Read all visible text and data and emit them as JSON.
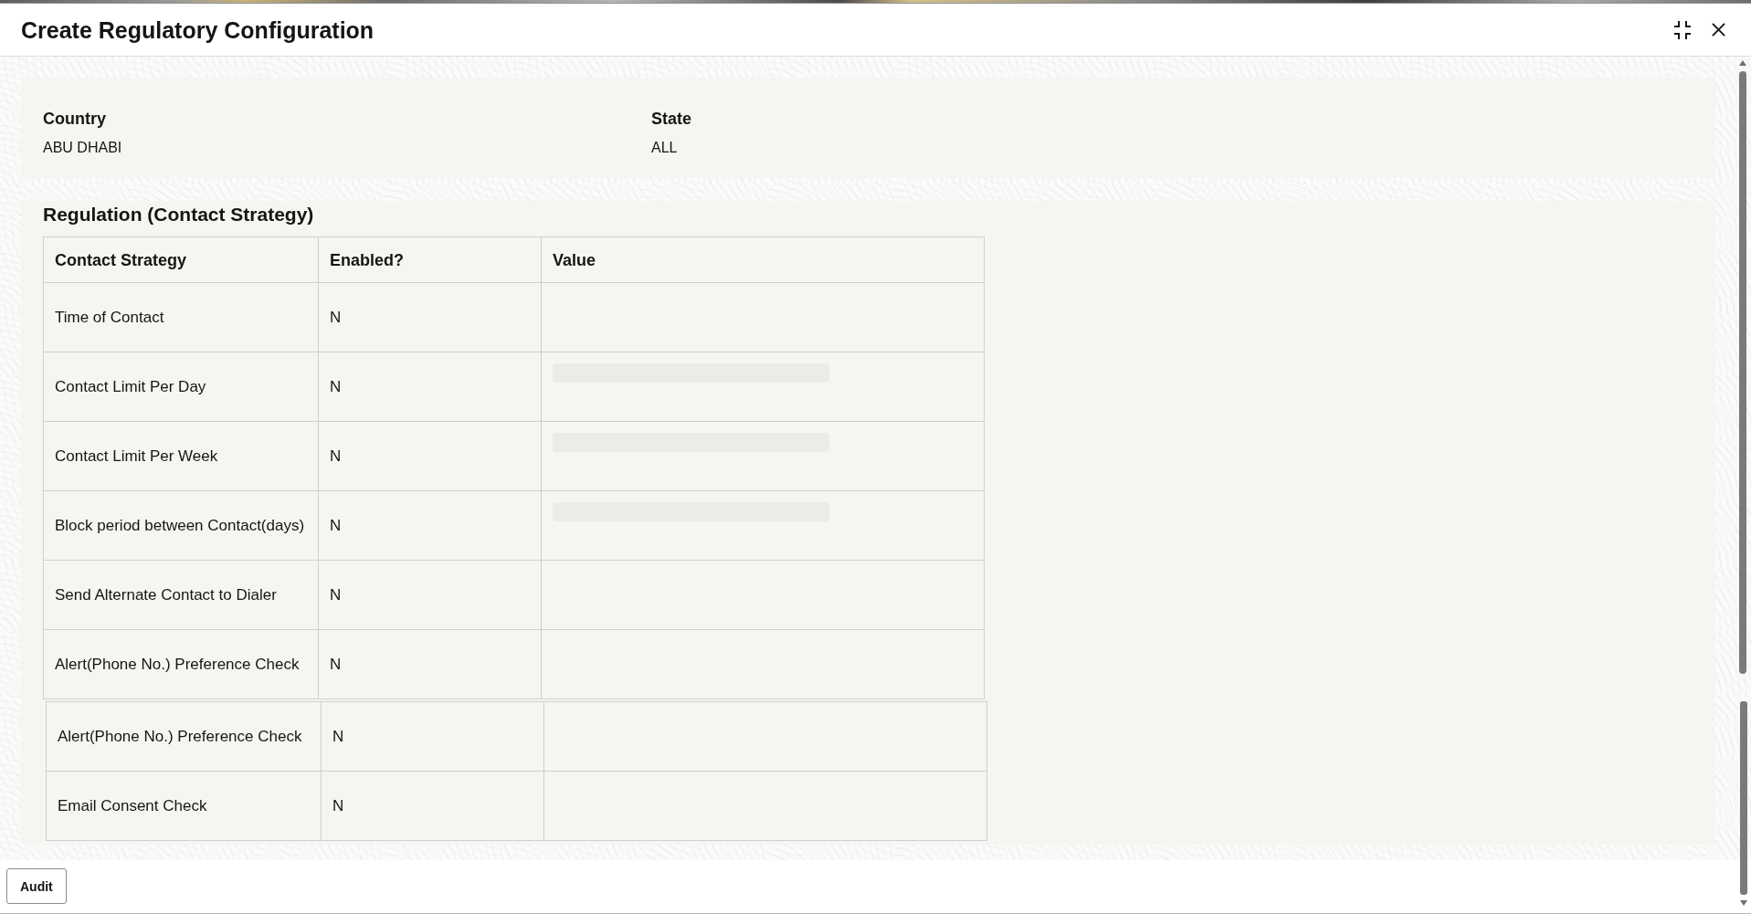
{
  "window": {
    "title": "Create Regulatory Configuration"
  },
  "location": {
    "fields": [
      {
        "label": "Country",
        "value": "ABU DHABI"
      },
      {
        "label": "State",
        "value": "ALL"
      }
    ]
  },
  "regulation": {
    "title": "Regulation (Contact Strategy)",
    "tables": [
      {
        "columns": [
          "Contact Strategy",
          "Enabled?",
          "Value"
        ],
        "rows": [
          {
            "strategy": "Time of Contact",
            "enabled": "N",
            "value_input": false
          },
          {
            "strategy": "Contact Limit Per Day",
            "enabled": "N",
            "value_input": true
          },
          {
            "strategy": "Contact Limit Per Week",
            "enabled": "N",
            "value_input": true
          },
          {
            "strategy": "Block period between Contact(days)",
            "enabled": "N",
            "value_input": true
          },
          {
            "strategy": "Send Alternate Contact to Dialer",
            "enabled": "N",
            "value_input": false
          },
          {
            "strategy": "Alert(Phone No.) Preference Check",
            "enabled": "N",
            "value_input": false
          }
        ]
      },
      {
        "rows": [
          {
            "strategy": "Alert(Phone No.) Preference Check",
            "enabled": "N",
            "value_input": false
          },
          {
            "strategy": "Email Consent Check",
            "enabled": "N",
            "value_input": false
          }
        ]
      }
    ]
  },
  "footer": {
    "buttons": [
      "Audit"
    ]
  }
}
